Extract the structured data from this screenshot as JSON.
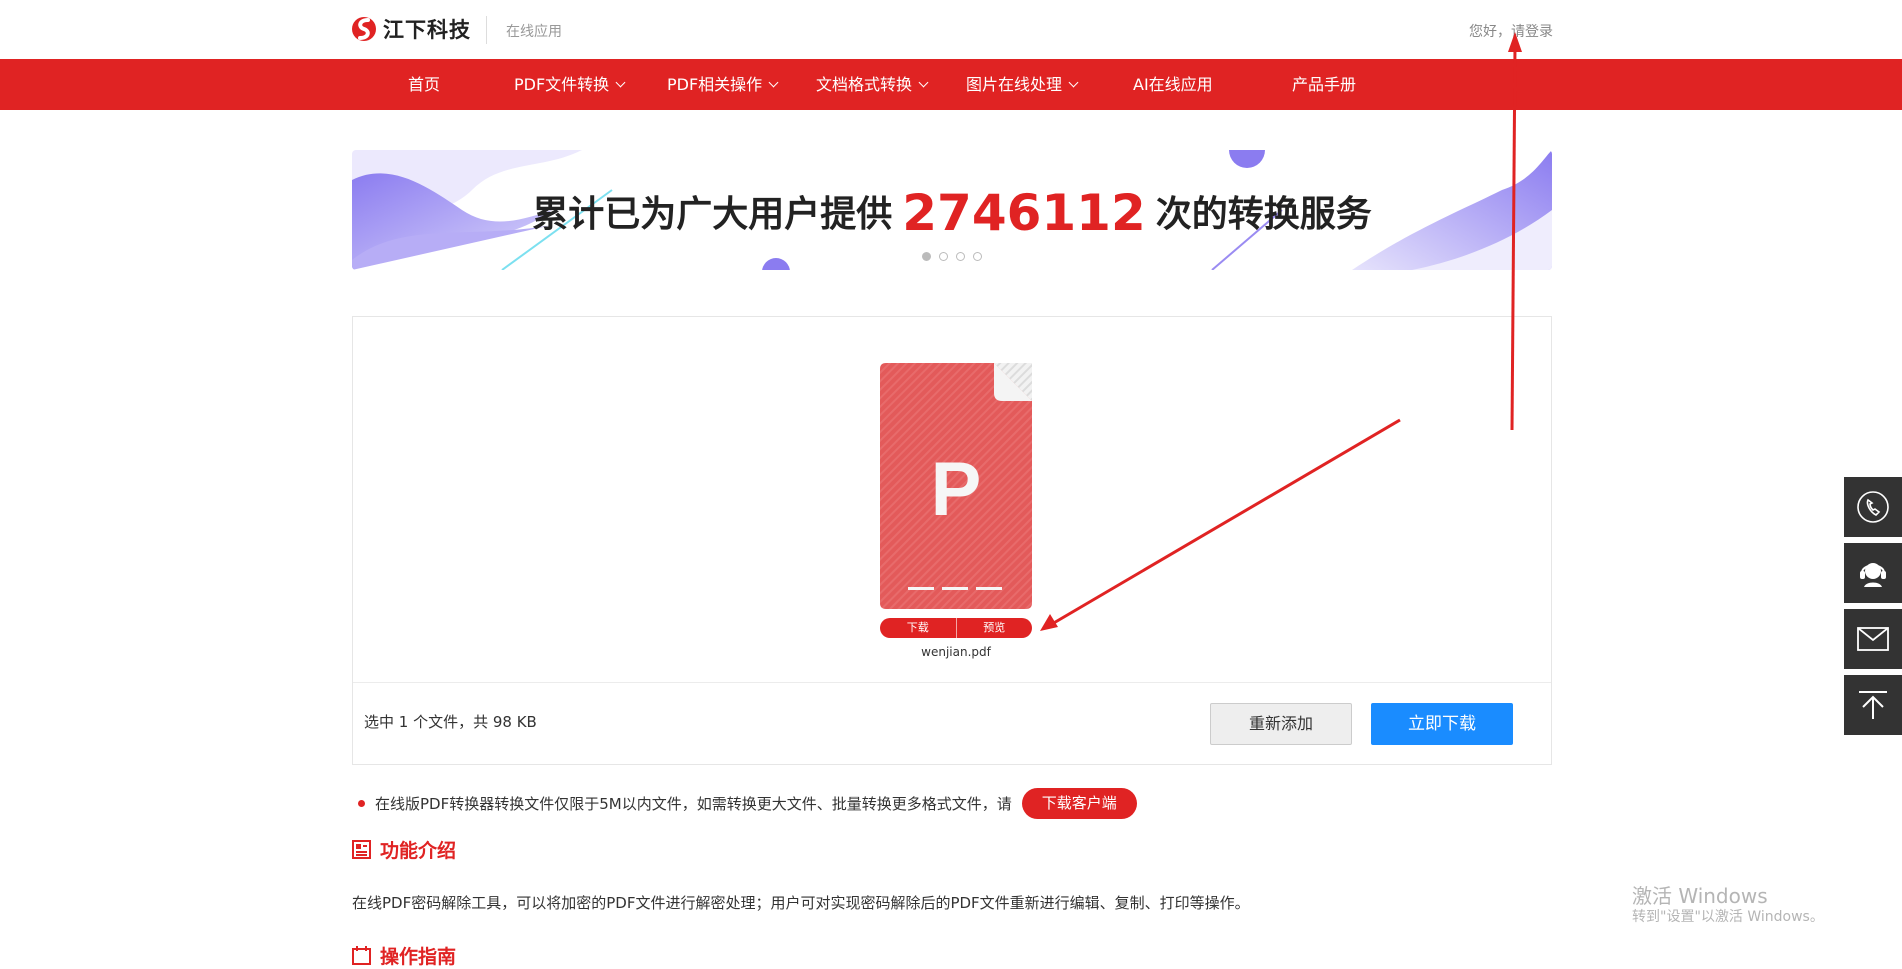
{
  "header": {
    "brand": "江下科技",
    "subtitle": "在线应用",
    "greeting_prefix": "您好，",
    "login_link": "请登录"
  },
  "nav": {
    "items": [
      {
        "label": "首页",
        "has_dropdown": false
      },
      {
        "label": "PDF文件转换",
        "has_dropdown": true
      },
      {
        "label": "PDF相关操作",
        "has_dropdown": true
      },
      {
        "label": "文档格式转换",
        "has_dropdown": true
      },
      {
        "label": "图片在线处理",
        "has_dropdown": true
      },
      {
        "label": "AI在线应用",
        "has_dropdown": false
      },
      {
        "label": "产品手册",
        "has_dropdown": false
      }
    ]
  },
  "banner": {
    "text_before": "累计已为广大用户提供",
    "count": "2746112",
    "text_after": "次的转换服务",
    "slide_count": 4,
    "active_slide": 1
  },
  "file_panel": {
    "file": {
      "icon_letter": "P",
      "name": "wenjian.pdf",
      "download_label": "下载",
      "preview_label": "预览"
    },
    "selected_info": "选中 1 个文件，共 98 KB",
    "readd_label": "重新添加",
    "download_now_label": "立即下载"
  },
  "notice": {
    "text": "在线版PDF转换器转换文件仅限于5M以内文件，如需转换更大文件、批量转换更多格式文件，请",
    "button_label": "下载客户端"
  },
  "intro": {
    "title": "功能介绍",
    "description": "在线PDF密码解除工具，可以将加密的PDF文件进行解密处理；用户可对实现密码解除后的PDF文件重新进行编辑、复制、打印等操作。"
  },
  "guide": {
    "title": "操作指南"
  },
  "side_toolbar": [
    "phone-icon",
    "customer-service-icon",
    "mail-icon",
    "back-to-top-icon"
  ],
  "watermark": {
    "line1": "激活 Windows",
    "line2": "转到\"设置\"以激活 Windows。"
  },
  "colors": {
    "brand_red": "#e02323",
    "primary_blue": "#1a8cff",
    "side_bar": "#333333"
  }
}
